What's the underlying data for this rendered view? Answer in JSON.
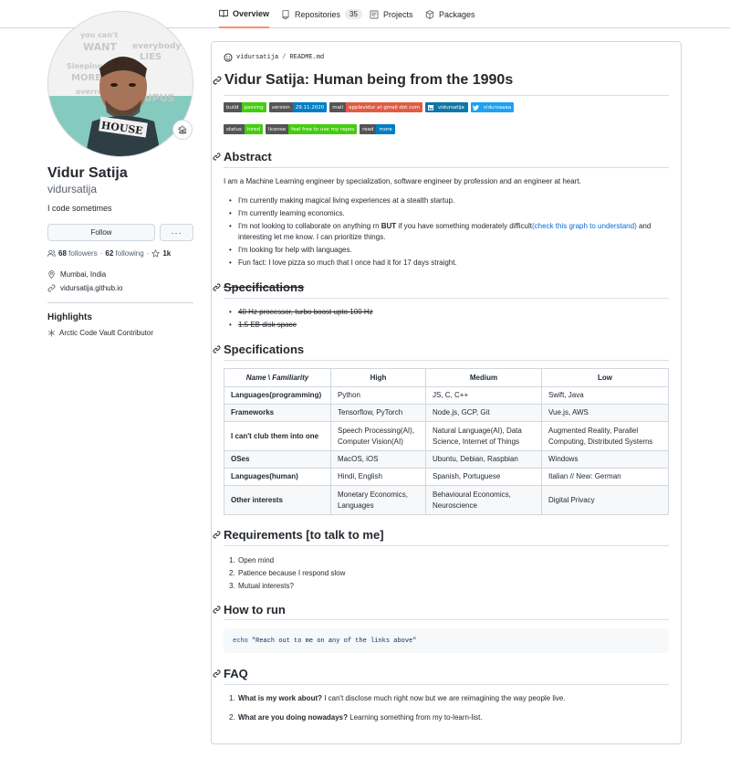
{
  "tabs": [
    {
      "label": "Overview"
    },
    {
      "label": "Repositories",
      "count": "35"
    },
    {
      "label": "Projects"
    },
    {
      "label": "Packages"
    }
  ],
  "profile": {
    "name": "Vidur Satija",
    "login": "vidursatija",
    "bio": "I code sometimes",
    "follow_label": "Follow",
    "more_label": "···",
    "followers_count": "68",
    "followers_label": "followers",
    "following_count": "62",
    "following_label": "following",
    "stars_count": "1k",
    "location": "Mumbai, India",
    "website": "vidursatija.github.io",
    "status_emoji": "🏚"
  },
  "highlights": {
    "title": "Highlights",
    "items": [
      "Arctic Code Vault Contributor"
    ]
  },
  "readme": {
    "path_user": "vidursatija",
    "path_sep": "/",
    "path_file": "README.md",
    "title": "Vidur Satija: Human being from the 1990s",
    "badges_row1": [
      {
        "label": "build",
        "value": "passing",
        "color": "#4c1"
      },
      {
        "label": "version",
        "value": "29.11.2020",
        "color": "#007ec6"
      },
      {
        "label": "mail",
        "value": "applevidur at gmail dot com",
        "color": "#e05d44"
      }
    ],
    "social_badges": [
      {
        "value": "vidursatija",
        "color": "#0e76a8"
      },
      {
        "value": "vidursaaaa",
        "color": "#1da1f2"
      }
    ],
    "badges_row2": [
      {
        "label": "status",
        "value": "hired",
        "color": "#4c1"
      },
      {
        "label": "license",
        "value": "feel free to use my repos",
        "color": "#4c1"
      },
      {
        "label": "read",
        "value": "more",
        "color": "#007ec6"
      }
    ],
    "abstract_heading": "Abstract",
    "abstract_text": "I am a Machine Learning engineer by specialization, software engineer by profession and an engineer at heart.",
    "bullets": [
      {
        "text": "I'm currently making magical living experiences at a stealth startup."
      },
      {
        "text": "I'm currently learning economics."
      },
      {
        "pre": "I'm not looking to collaborate on anything rn ",
        "bold": "BUT",
        "mid": " if you have something moderately difficult",
        "link": "(check this graph to understand)",
        "post": " and interesting let me know. I can prioritize things."
      },
      {
        "text": "I'm looking for help with languages."
      },
      {
        "text": "Fun fact: I love pizza so much that I once had it for 17 days straight."
      }
    ],
    "old_spec_heading": "Specifications",
    "old_spec_items": [
      "40 Hz processor, turbo boost upto 100 Hz",
      "1.5 EB disk space"
    ],
    "spec_heading": "Specifications",
    "table": {
      "headers": [
        "Name \\ Familiarity",
        "High",
        "Medium",
        "Low"
      ],
      "rows": [
        [
          "Languages(programming)",
          "Python",
          "JS, C, C++",
          "Swift, Java"
        ],
        [
          "Frameworks",
          "Tensorflow, PyTorch",
          "Node.js, GCP, Git",
          "Vue.js, AWS"
        ],
        [
          "I can't club them into one",
          "Speech Processing(AI), Computer Vision(AI)",
          "Natural Language(AI), Data Science, Internet of Things",
          "Augmented Reality, Parallel Computing, Distributed Systems"
        ],
        [
          "OSes",
          "MacOS, iOS",
          "Ubuntu, Debian, Raspbian",
          "Windows"
        ],
        [
          "Languages(human)",
          "Hindi, English",
          "Spanish, Portuguese",
          "Italian // New: German"
        ],
        [
          "Other interests",
          "Monetary Economics, Languages",
          "Behavioural Economics, Neuroscience",
          "Digital Privacy"
        ]
      ]
    },
    "req_heading": "Requirements [to talk to me]",
    "req_items": [
      "Open mind",
      "Patience because I respond slow",
      "Mutual interests?"
    ],
    "run_heading": "How to run",
    "code_keyword": "echo",
    "code_string": "\"Reach out to me on any of the links above\"",
    "faq_heading": "FAQ",
    "faq": [
      {
        "q": "What is my work about?",
        "a": " I can't disclose much right now but we are reimagining the way people live."
      },
      {
        "q": "What are you doing nowadays?",
        "a": " Learning something from my to-learn-list."
      }
    ]
  }
}
